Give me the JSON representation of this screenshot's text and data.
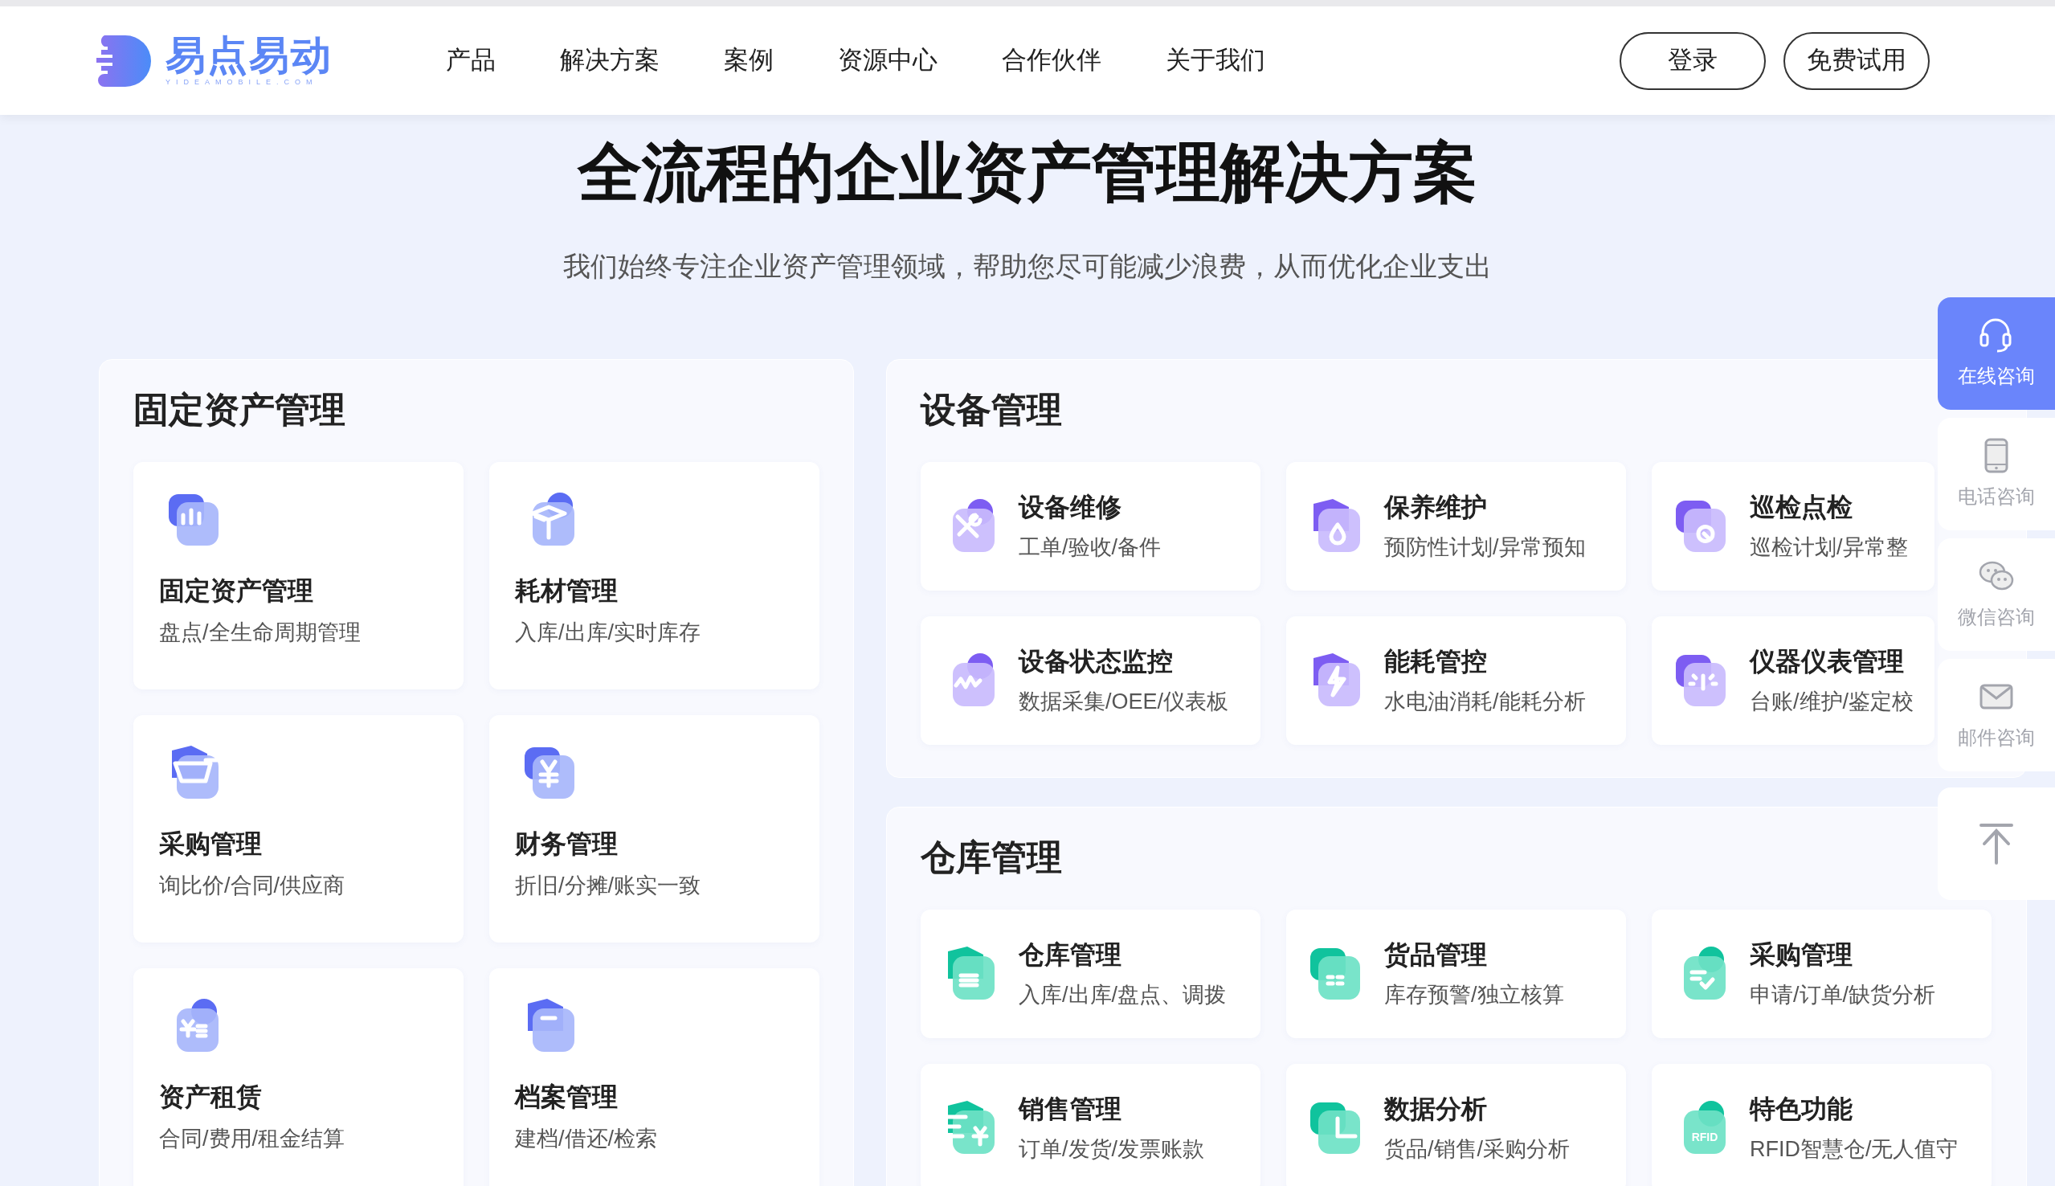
{
  "header": {
    "logo": {
      "name": "易点易动",
      "tagline": "YIDEAMOBILE.COM"
    },
    "nav": [
      "产品",
      "解决方案",
      "案例",
      "资源中心",
      "合作伙伴",
      "关于我们"
    ],
    "buttons": [
      "登录",
      "免费试用"
    ]
  },
  "hero": {
    "title": "全流程的企业资产管理解决方案",
    "subtitle": "我们始终专注企业资产管理领域，帮助您尽可能减少浪费，从而优化企业支出"
  },
  "sections": [
    {
      "title": "固定资产管理",
      "kind": "tall",
      "items": [
        {
          "title": "固定资产管理",
          "subtitle": "盘点/全生命周期管理"
        },
        {
          "title": "耗材管理",
          "subtitle": "入库/出库/实时库存"
        },
        {
          "title": "采购管理",
          "subtitle": "询比价/合同/供应商"
        },
        {
          "title": "财务管理",
          "subtitle": "折旧/分摊/账实一致"
        },
        {
          "title": "资产租赁",
          "subtitle": "合同/费用/租金结算"
        },
        {
          "title": "档案管理",
          "subtitle": "建档/借还/检索"
        }
      ]
    },
    {
      "title": "设备管理",
      "kind": "compact",
      "items": [
        {
          "title": "设备维修",
          "subtitle": "工单/验收/备件"
        },
        {
          "title": "保养维护",
          "subtitle": "预防性计划/异常预知"
        },
        {
          "title": "巡检点检",
          "subtitle": "巡检计划/异常整"
        },
        {
          "title": "设备状态监控",
          "subtitle": "数据采集/OEE/仪表板"
        },
        {
          "title": "能耗管控",
          "subtitle": "水电油消耗/能耗分析"
        },
        {
          "title": "仪器仪表管理",
          "subtitle": "台账/维护/鉴定校"
        }
      ]
    },
    {
      "title": "仓库管理",
      "kind": "compact",
      "items": [
        {
          "title": "仓库管理",
          "subtitle": "入库/出库/盘点、调拨"
        },
        {
          "title": "货品管理",
          "subtitle": "库存预警/独立核算"
        },
        {
          "title": "采购管理",
          "subtitle": "申请/订单/缺货分析"
        },
        {
          "title": "销售管理",
          "subtitle": "订单/发货/发票账款"
        },
        {
          "title": "数据分析",
          "subtitle": "货品/销售/采购分析"
        },
        {
          "title": "特色功能",
          "subtitle": "RFID智慧仓/无人值守",
          "badge": "RFID"
        }
      ]
    }
  ],
  "sidebar": [
    {
      "label": "在线咨询",
      "selected": true
    },
    {
      "label": "电话咨询",
      "selected": false
    },
    {
      "label": "微信咨询",
      "selected": false
    },
    {
      "label": "邮件咨询",
      "selected": false
    }
  ]
}
